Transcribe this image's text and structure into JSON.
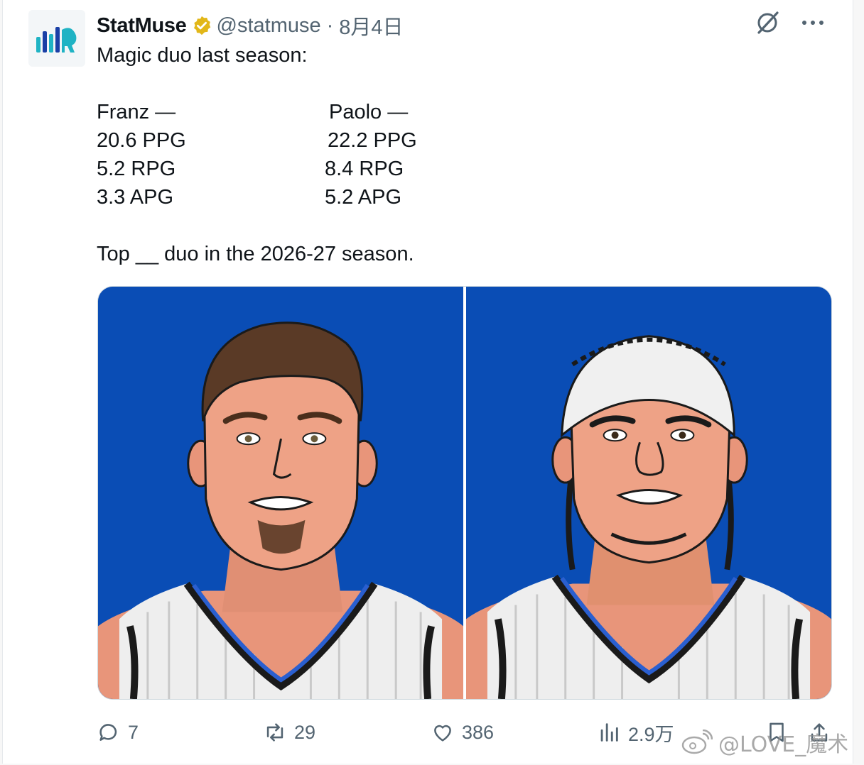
{
  "account": {
    "display_name": "StatMuse",
    "handle": "@statmuse",
    "separator": "·",
    "date": "8月4日",
    "verified_icon": "verified-badge-icon",
    "logo_icon": "statmuse-logo"
  },
  "tweet": {
    "intro": "Magic duo last season:",
    "stats": {
      "left_header": "Franz —",
      "right_header": "Paolo —",
      "left": [
        "20.6 PPG",
        "5.2 RPG",
        "3.3 APG"
      ],
      "right": [
        "22.2 PPG",
        "8.4 RPG",
        "5.2 APG"
      ]
    },
    "closing": "Top __ duo in the 2026-27 season."
  },
  "media": {
    "background_color": "#0a4db5",
    "panels": [
      "player-illustration-left",
      "player-illustration-right"
    ]
  },
  "actions": {
    "replies": "7",
    "reposts": "29",
    "likes": "386",
    "views": "2.9万"
  },
  "watermark": {
    "text": "@LOVE_魔术"
  },
  "colors": {
    "text": "#0f1419",
    "secondary": "#536471",
    "verified": "#e2b719",
    "logo_teal": "#1fb3c4",
    "logo_blue": "#1a3fa6"
  }
}
